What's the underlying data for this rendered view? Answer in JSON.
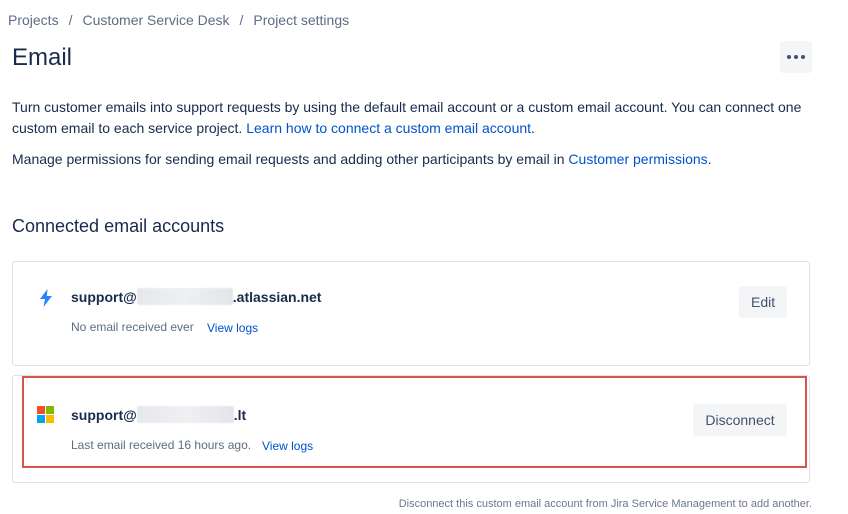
{
  "breadcrumb": {
    "items": [
      "Projects",
      "Customer Service Desk",
      "Project settings"
    ],
    "separator": "/"
  },
  "page": {
    "title": "Email",
    "more_icon": "more-horizontal-icon"
  },
  "description": {
    "line1_text": "Turn customer emails into support requests by using the default email account or a custom email account. You can connect one custom email to each service project. ",
    "line1_link": "Learn how to connect a custom email account",
    "line1_end": ".",
    "line2_text": "Manage permissions for sending email requests and adding other participants by email in ",
    "line2_link": "Customer permissions",
    "line2_end": "."
  },
  "section": {
    "title": "Connected email accounts"
  },
  "accounts": [
    {
      "icon": "lightning-bolt-icon",
      "email_prefix": "support@",
      "email_suffix": ".atlassian.net",
      "status": "No email received ever",
      "view_logs": "View logs",
      "action": "Edit"
    },
    {
      "icon": "microsoft-logo-icon",
      "email_prefix": "support@",
      "email_suffix": ".lt",
      "status": "Last email received 16 hours ago.",
      "view_logs": "View logs",
      "action": "Disconnect"
    }
  ],
  "colors": {
    "link": "#0052cc",
    "highlight_border": "#d9534f",
    "bolt": "#2684ff",
    "ms_red": "#f25022",
    "ms_green": "#7fba00",
    "ms_blue": "#00a4ef",
    "ms_yellow": "#ffb900"
  },
  "footnote": "Disconnect this custom email account from Jira Service Management to add another."
}
